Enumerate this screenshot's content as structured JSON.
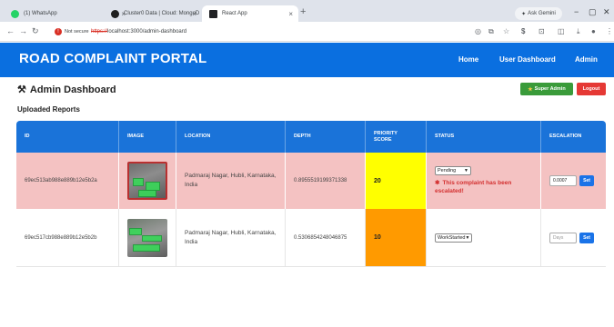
{
  "browser": {
    "tabs": [
      {
        "label": "(1) WhatsApp",
        "favicon_color": "#25d366"
      },
      {
        "label": "Cluster0 Data | Cloud: MongoD",
        "favicon_color": "#1f1f1f"
      },
      {
        "label": "React App",
        "favicon_color": "#202124"
      }
    ],
    "new_tab": "+",
    "ask_gemini": "Ask Gemini",
    "not_secure": "Not secure",
    "url_protocol": "https://",
    "url_rest": "localhost:3000/admin-dashboard"
  },
  "navbar": {
    "brand": "ROAD COMPLAINT PORTAL",
    "links": [
      "Home",
      "User Dashboard",
      "Admin"
    ]
  },
  "header": {
    "title": "Admin Dashboard",
    "super_admin_label": "Super Admin",
    "logout_label": "Logout"
  },
  "section": {
    "title": "Uploaded Reports"
  },
  "table": {
    "columns": [
      "ID",
      "IMAGE",
      "LOCATION",
      "DEPTH",
      "PRIORITY SCORE",
      "STATUS",
      "ESCALATION"
    ],
    "rows": [
      {
        "id": "69ec513ab988e889b12e5b2a",
        "location": "Padmaraj Nagar, Hubli, Karnataka, India",
        "depth": "0.8955519199371338",
        "priority_score": "20",
        "priority_color": "#ffff00",
        "status": "Pending",
        "escalation_message": "This complaint has been escalated!",
        "escalation_value": "0.0007",
        "set_label": "Set",
        "row_color": "#f4c2c2"
      },
      {
        "id": "69ec517cb988e889b12e5b2b",
        "location": "Padmaraj Nagar, Hubli, Karnataka, India",
        "depth": "0.5306854248046875",
        "priority_score": "10",
        "priority_color": "#ff9a00",
        "status": "WorkStarted",
        "escalation_placeholder": "Days",
        "set_label": "Set",
        "row_color": "#ffffff"
      }
    ]
  }
}
